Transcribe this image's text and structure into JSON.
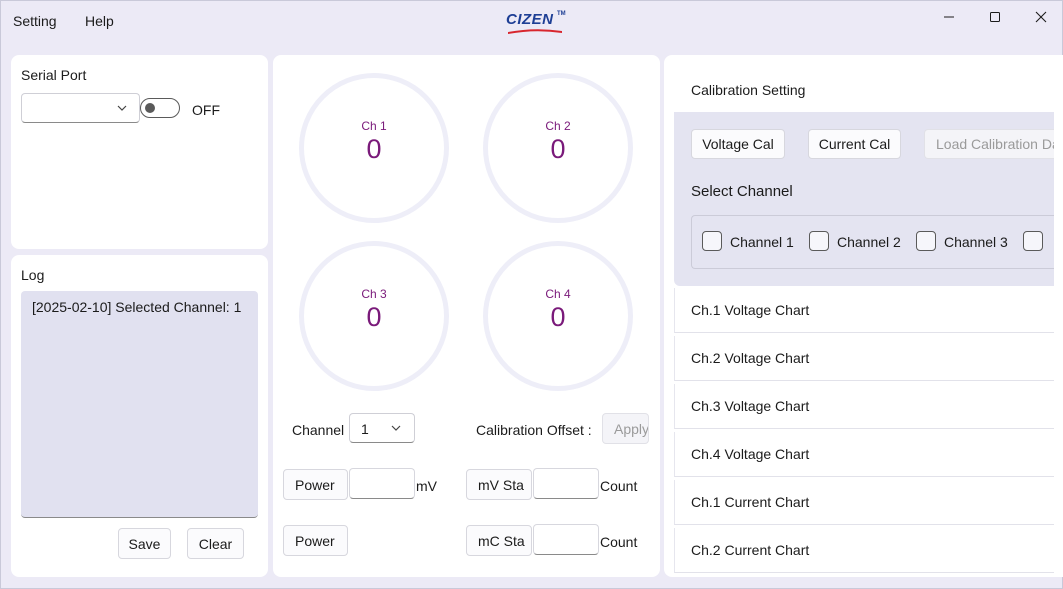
{
  "menu": {
    "setting": "Setting",
    "help": "Help"
  },
  "brand": {
    "logo_text": "CIZEN",
    "tm": "TM"
  },
  "serial": {
    "title": "Serial Port",
    "port_value": "",
    "toggle_state": "OFF"
  },
  "log": {
    "title": "Log",
    "lines": [
      "[2025-02-10] Selected Channel: 1"
    ],
    "save_label": "Save",
    "clear_label": "Clear"
  },
  "gauges": [
    {
      "label": "Ch 1",
      "value": "0"
    },
    {
      "label": "Ch 2",
      "value": "0"
    },
    {
      "label": "Ch 3",
      "value": "0"
    },
    {
      "label": "Ch 4",
      "value": "0"
    }
  ],
  "controls": {
    "channel_label": "Channel",
    "channel_value": "1",
    "calibration_offset_label": "Calibration Offset :",
    "apply_label": "Apply",
    "power_btn_1": "Power",
    "power_btn_2": "Power",
    "mv_unit": "mV",
    "mv_std_btn": "mV Sta",
    "mc_std_btn": "mC Sta",
    "count_1": "Count",
    "count_2": "Count"
  },
  "calibration": {
    "title": "Calibration Setting",
    "voltage_cal": "Voltage Cal",
    "current_cal": "Current Cal",
    "load_cal": "Load Calibration Da",
    "select_channel": "Select Channel",
    "channels": [
      "Channel 1",
      "Channel 2",
      "Channel 3"
    ]
  },
  "charts": [
    "Ch.1 Voltage Chart",
    "Ch.2 Voltage Chart",
    "Ch.3 Voltage Chart",
    "Ch.4 Voltage Chart",
    "Ch.1 Current Chart",
    "Ch.2 Current Chart"
  ],
  "colors": {
    "gauge_text": "#7a1a7a",
    "brand": "#1e3f95",
    "brand_accent": "#d8262e"
  }
}
